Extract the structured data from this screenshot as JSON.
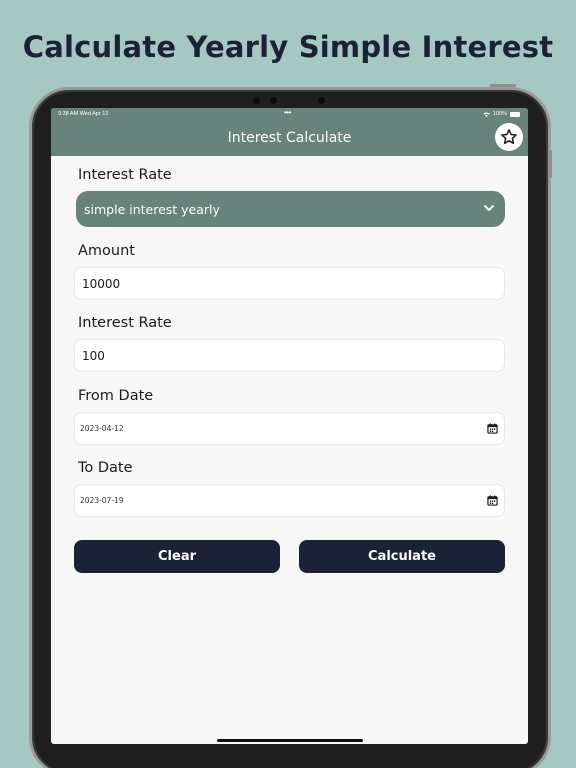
{
  "headline": "Calculate Yearly Simple Interest",
  "status_bar": {
    "time": "9:38 AM  Wed Apr 12",
    "dots": "•••",
    "battery_text": "100%"
  },
  "app_bar": {
    "title": "Interest Calculate",
    "favorite_icon": "star-icon"
  },
  "form": {
    "interest_type": {
      "label": "Interest Rate",
      "selected": "simple interest yearly"
    },
    "amount": {
      "label": "Amount",
      "value": "10000"
    },
    "interest_rate": {
      "label": "Interest Rate",
      "value": "100"
    },
    "from_date": {
      "label": "From Date",
      "value": "2023-04-12"
    },
    "to_date": {
      "label": "To Date",
      "value": "2023-07-19"
    }
  },
  "buttons": {
    "clear": "Clear",
    "calculate": "Calculate"
  },
  "colors": {
    "background": "#a5c8c2",
    "app_bar": "#67837c",
    "button": "#1b2235",
    "screen": "#f7f7f7"
  }
}
